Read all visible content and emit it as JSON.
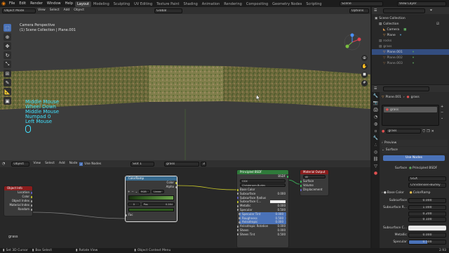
{
  "topbar": {
    "menus": [
      "File",
      "Edit",
      "Render",
      "Window",
      "Help"
    ],
    "workspaces": [
      "Layout",
      "Modeling",
      "Sculpting",
      "UV Editing",
      "Texture Paint",
      "Shading",
      "Animation",
      "Rendering",
      "Compositing",
      "Geometry Nodes",
      "Scripting"
    ],
    "scene": "Scene",
    "view_layer": "View Layer"
  },
  "viewport_header": {
    "mode": "Object Mode",
    "menus": [
      "View",
      "Select",
      "Add",
      "Object"
    ],
    "orientation": "Global",
    "options": "Options"
  },
  "viewport": {
    "camera_label": "Camera Perspective",
    "collection_label": "(1) Scene Collection | Plane.001",
    "overlay_keys": [
      "Middle Mouse",
      "Wheel Down",
      "Middle Mouse",
      "Numpad 0",
      "Left Mouse"
    ]
  },
  "outliner": {
    "title": "Scene Collection",
    "items": [
      {
        "label": "Collection",
        "indent": 1
      },
      {
        "label": "Camera",
        "indent": 2
      },
      {
        "label": "Plane",
        "indent": 2
      },
      {
        "label": "rocks",
        "indent": 1
      },
      {
        "label": "grass",
        "indent": 1
      },
      {
        "label": "Plane.001",
        "indent": 2
      },
      {
        "label": "Plane.002",
        "indent": 2
      },
      {
        "label": "Plane.003",
        "indent": 2
      }
    ]
  },
  "properties": {
    "object_name": "Plane.001",
    "material_short": "grass",
    "material_slot": "grass",
    "material_field": "grass",
    "preview_label": "Preview",
    "surface_label": "Surface",
    "use_nodes": "Use Nodes",
    "surface_row_label": "Surface",
    "surface_value": "Principled BSDF",
    "distribution": "GGX",
    "subsurface_method": "Christensen-Burley",
    "base_color_label": "Base Color",
    "base_color_value": "ColorRamp",
    "subsurface_label": "Subsurface",
    "subsurface_value": "0.000",
    "subsurface_radius_label": "Subsurface R...",
    "radius": [
      "1.000",
      "0.200",
      "0.100"
    ],
    "subsurface_color_label": "Subsurface C...",
    "metallic_label": "Metallic",
    "metallic_value": "0.000",
    "specular_label": "Specular",
    "specular_value": "0.500",
    "specular_fraction": 0.5
  },
  "node_editor": {
    "header_menus": [
      "View",
      "Select",
      "Add",
      "Node"
    ],
    "object_label": "Object",
    "use_nodes_label": "Use Nodes",
    "slot_label": "Slot 1",
    "material_label": "grass",
    "users": "3",
    "bottom_label": "grass",
    "nodes": {
      "object_info": {
        "title": "Object Info",
        "outputs": [
          "Location",
          "Color",
          "Object Index",
          "Material Index",
          "Random"
        ]
      },
      "colorramp": {
        "title": "ColorRamp",
        "outputs": [
          "Color",
          "Alpha"
        ],
        "mode": "RGB",
        "interp": "Linear",
        "stop_index": "0",
        "pos_label": "Pos",
        "pos_value": "0.284",
        "input": "Fac"
      },
      "principled": {
        "title": "Principled BSDF",
        "output": "BSDF",
        "distribution": "GGX",
        "method": "Christensen-Burley",
        "rows": [
          {
            "label": "Base Color",
            "value": ""
          },
          {
            "label": "Subsurface",
            "value": "0.000"
          },
          {
            "label": "Subsurface Radius",
            "value": ""
          },
          {
            "label": "Subsurface C...",
            "value": ""
          },
          {
            "label": "Metallic",
            "value": "0.000"
          },
          {
            "label": "Specular",
            "value": "0.500"
          },
          {
            "label": "Specular Tint",
            "value": "0.000"
          },
          {
            "label": "Roughness",
            "value": "0.500"
          },
          {
            "label": "Anisotropic",
            "value": "0.000"
          },
          {
            "label": "Anisotropic Rotation",
            "value": "0.000"
          },
          {
            "label": "Sheen",
            "value": "0.000"
          },
          {
            "label": "Sheen Tint",
            "value": "0.500"
          }
        ]
      },
      "material_output": {
        "title": "Material Output",
        "target": "All",
        "inputs": [
          "Surface",
          "Volume",
          "Displacement"
        ]
      }
    }
  },
  "statusbar": {
    "items": [
      "Set 3D Cursor",
      "Box Select",
      "Rotate View",
      "Object Context Menu"
    ],
    "version": "2.93"
  },
  "colors": {
    "accent": "#4a72b8",
    "overlay_text": "#41e1ff",
    "node_object_info": "#8a1c1c",
    "node_colorramp": "#386b8f",
    "node_principled": "#2f7a3a",
    "node_output": "#8a1c1c"
  }
}
